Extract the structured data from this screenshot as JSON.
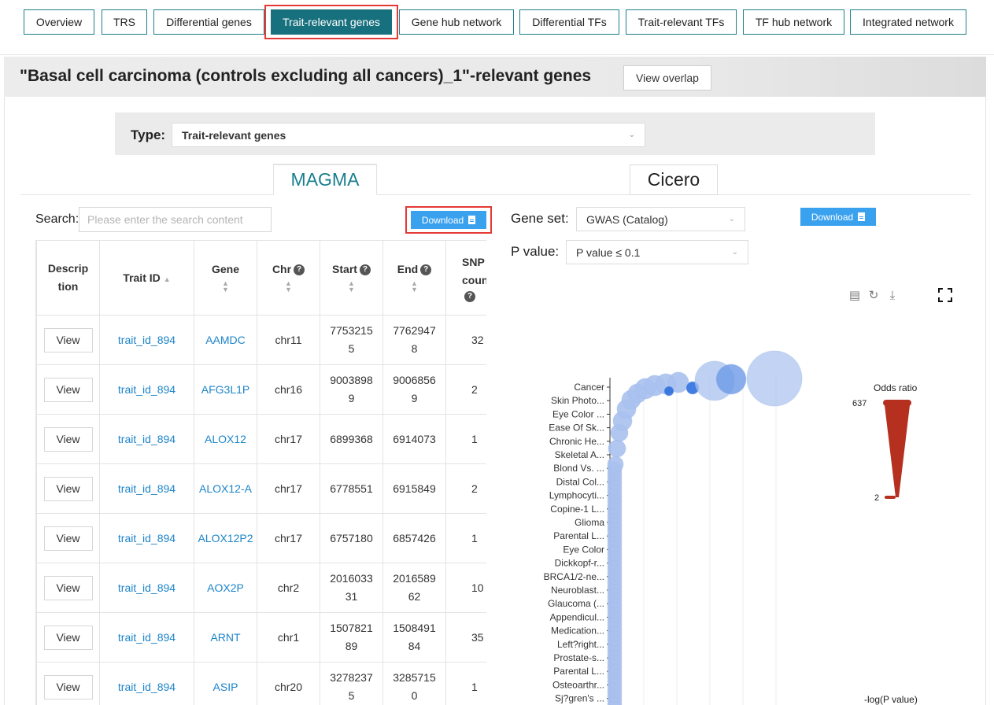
{
  "nav": {
    "tabs": [
      "Overview",
      "TRS",
      "Differential genes",
      "Trait-relevant genes",
      "Gene hub network",
      "Differential TFs",
      "Trait-relevant TFs",
      "TF hub network",
      "Integrated network"
    ],
    "active": "Trait-relevant genes"
  },
  "header": {
    "title": "\"Basal cell carcinoma (controls excluding all cancers)_1\"-relevant genes",
    "overlap_button": "View overlap"
  },
  "type_filter": {
    "label": "Type:",
    "value": "Trait-relevant genes"
  },
  "method_tabs": {
    "magma": "MAGMA",
    "cicero": "Cicero"
  },
  "left": {
    "search_label": "Search:",
    "search_placeholder": "Please enter the search content",
    "download": "Download",
    "columns": [
      "Descrip tion",
      "Trait ID",
      "Gene",
      "Chr",
      "Start",
      "End",
      "SNP count"
    ],
    "rows": [
      {
        "view": "View",
        "trait": "trait_id_894",
        "gene": "AAMDC",
        "chr": "chr11",
        "start": "7753215 5",
        "end": "7762947 8",
        "snp": "32"
      },
      {
        "view": "View",
        "trait": "trait_id_894",
        "gene": "AFG3L1P",
        "chr": "chr16",
        "start": "9003898 9",
        "end": "9006856 9",
        "snp": "2"
      },
      {
        "view": "View",
        "trait": "trait_id_894",
        "gene": "ALOX12",
        "chr": "chr17",
        "start": "6899368",
        "end": "6914073",
        "snp": "1"
      },
      {
        "view": "View",
        "trait": "trait_id_894",
        "gene": "ALOX12-A",
        "chr": "chr17",
        "start": "6778551",
        "end": "6915849",
        "snp": "2"
      },
      {
        "view": "View",
        "trait": "trait_id_894",
        "gene": "ALOX12P2",
        "chr": "chr17",
        "start": "6757180",
        "end": "6857426",
        "snp": "1"
      },
      {
        "view": "View",
        "trait": "trait_id_894",
        "gene": "AOX2P",
        "chr": "chr2",
        "start": "2016033 31",
        "end": "2016589 62",
        "snp": "10"
      },
      {
        "view": "View",
        "trait": "trait_id_894",
        "gene": "ARNT",
        "chr": "chr1",
        "start": "1507821 89",
        "end": "1508491 84",
        "snp": "35"
      },
      {
        "view": "View",
        "trait": "trait_id_894",
        "gene": "ASIP",
        "chr": "chr20",
        "start": "3278237 5",
        "end": "3285715 0",
        "snp": "1"
      }
    ]
  },
  "right": {
    "download": "Download",
    "gene_set_label": "Gene set:",
    "gene_set_value": "GWAS (Catalog)",
    "pvalue_label": "P value:",
    "pvalue_value": "P value ≤ 0.1",
    "icons": [
      "data-view-icon",
      "refresh-icon",
      "save-image-icon",
      "fullscreen-icon"
    ]
  },
  "chart_data": {
    "type": "scatter",
    "categories": [
      "Cancer",
      "Skin Photo...",
      "Eye Color ...",
      "Ease Of Sk...",
      "Chronic He...",
      "Skeletal A...",
      "Blond Vs. ...",
      "Distal Col...",
      "Lymphocyti...",
      "Copine-1 L...",
      "Glioma",
      "Parental L...",
      "Eye Color",
      "Dickkopf-r...",
      "BRCA1/2-ne...",
      "Neuroblast...",
      "Glaucoma (...",
      "Appendicul...",
      "Medication...",
      "Left?right...",
      "Prostate-s...",
      "Parental L...",
      "Osteoarthr...",
      "Sj?gren's ..."
    ],
    "legend_title": "Odds ratio",
    "legend_max": "637",
    "legend_min": "2",
    "xlabel": "-log(P value)"
  }
}
